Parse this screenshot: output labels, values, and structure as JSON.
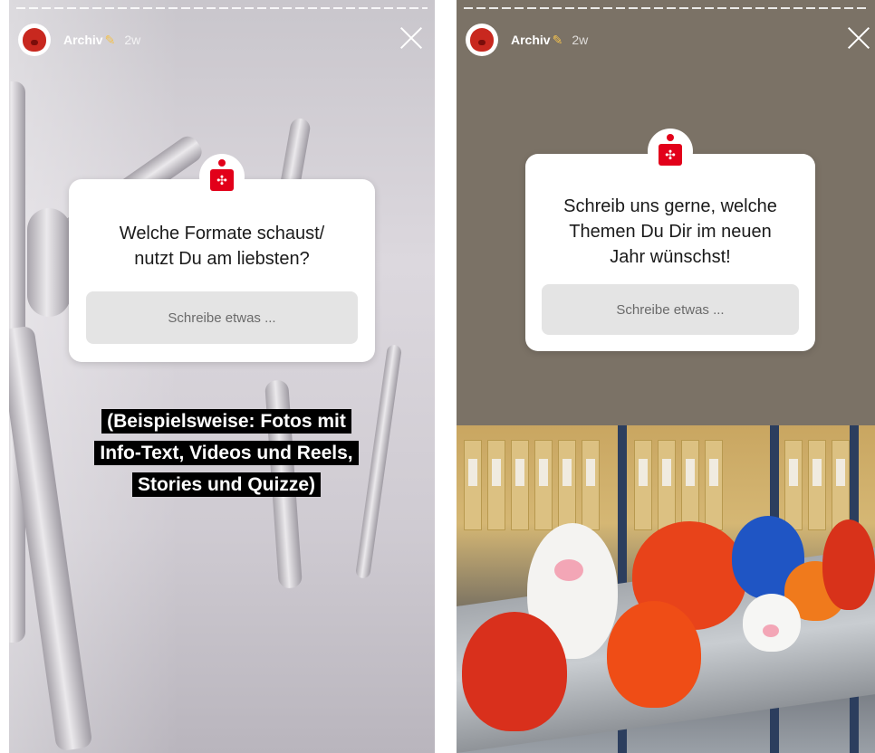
{
  "stories": [
    {
      "account": {
        "name": "Archiv",
        "edit_icon": "pencil-icon",
        "time_ago": "2w"
      },
      "question": "Welche Formate schaust/\nnutzt Du am liebsten?",
      "input_placeholder": "Schreibe etwas ...",
      "caption": "(Beispielsweise: Fotos mit Info-Text, Videos und Reels, Stories und Quizze)"
    },
    {
      "account": {
        "name": "Archiv",
        "edit_icon": "pencil-icon",
        "time_ago": "2w"
      },
      "question": "Schreib uns gerne, welche\nThemen Du Dir im neuen\nJahr wünschst!",
      "input_placeholder": "Schreibe etwas ..."
    }
  ],
  "colors": {
    "brand_red": "#e2001a",
    "caption_bg": "#000000",
    "card_bg": "#ffffff",
    "input_bg": "#e4e4e4"
  }
}
